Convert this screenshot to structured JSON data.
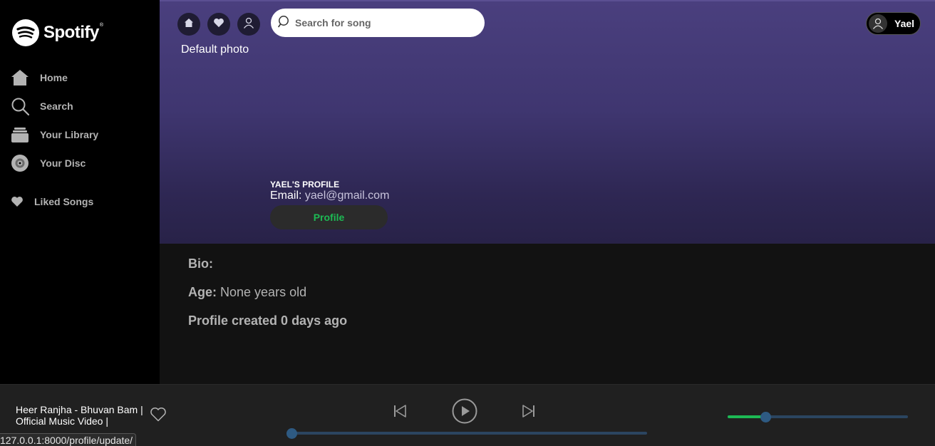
{
  "brand": {
    "name": "Spotify",
    "mark": "®"
  },
  "sidebar": {
    "items": [
      {
        "label": "Home",
        "icon": "home-icon"
      },
      {
        "label": "Search",
        "icon": "search-icon"
      },
      {
        "label": "Your Library",
        "icon": "library-icon"
      },
      {
        "label": "Your Disc",
        "icon": "disc-icon"
      }
    ],
    "liked": {
      "label": "Liked Songs",
      "icon": "heart-icon"
    }
  },
  "header": {
    "search_placeholder": "Search for song",
    "user_name": "Yael"
  },
  "profile": {
    "default_photo": "Default photo",
    "title": "YAEL'S PROFILE",
    "email_label": "Email:",
    "email_value": "yael@gmail.com",
    "button_label": "Profile",
    "bio_label": "Bio:",
    "age_label": "Age:",
    "age_value": "None years old",
    "created_text": "Profile created 0 days ago"
  },
  "player": {
    "track_title": "Heer Ranjha - Bhuvan Bam | Official Music Video |",
    "progress": 0.0,
    "volume": 0.21
  },
  "status_url": "127.0.0.1:8000/profile/update/",
  "colors": {
    "accent": "#1db954",
    "hero_top": "#4a3f7e",
    "hero_bottom": "#282248",
    "sidebar_bg": "#000000",
    "content_bg": "#121212",
    "player_bg": "#202020"
  }
}
